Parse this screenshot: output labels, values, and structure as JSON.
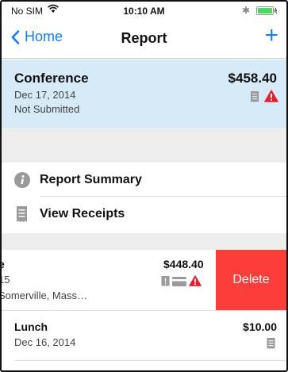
{
  "status_bar": {
    "carrier": "No SIM",
    "time": "10:10 AM",
    "bluetooth": "✱"
  },
  "nav": {
    "back_label": "Home",
    "title": "Report",
    "add_label": "+"
  },
  "report": {
    "name": "Conference",
    "date": "Dec 17, 2014",
    "status": "Not Submitted",
    "amount": "$458.40"
  },
  "menu": {
    "items": [
      {
        "label": "Report Summary",
        "icon": "info-icon"
      },
      {
        "label": "View Receipts",
        "icon": "receipt-icon"
      }
    ]
  },
  "expenses": [
    {
      "name": "e",
      "date": "15",
      "location": "Somerville, Mass…",
      "amount": "$448.40",
      "delete_label": "Delete"
    },
    {
      "name": "Lunch",
      "date": "Dec 16, 2014",
      "amount": "$10.00"
    }
  ],
  "colors": {
    "accent": "#157efb",
    "header_bg": "#d6ebf7",
    "delete": "#fc3d39",
    "alert": "#e5202e",
    "battery": "#4cd964"
  }
}
